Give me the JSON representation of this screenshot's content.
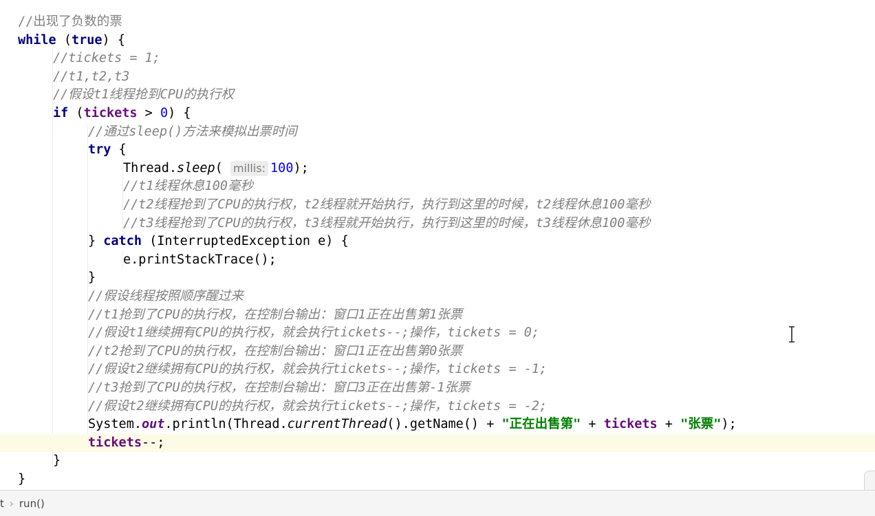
{
  "editor": {
    "lines": [
      {
        "indent": 1,
        "tokens": [
          {
            "t": "//出现了负数的票",
            "c": "cm-plain"
          }
        ]
      },
      {
        "indent": 1,
        "tokens": [
          {
            "t": "while",
            "c": "kw"
          },
          {
            "t": " (",
            "c": ""
          },
          {
            "t": "true",
            "c": "kw"
          },
          {
            "t": ") {",
            "c": ""
          }
        ]
      },
      {
        "indent": 2,
        "tokens": [
          {
            "t": "//tickets = 1;",
            "c": "cm"
          }
        ]
      },
      {
        "indent": 2,
        "tokens": [
          {
            "t": "//t1,t2,t3",
            "c": "cm"
          }
        ]
      },
      {
        "indent": 2,
        "tokens": [
          {
            "t": "//假设t1线程抢到CPU的执行权",
            "c": "cm"
          }
        ]
      },
      {
        "indent": 2,
        "tokens": [
          {
            "t": "if",
            "c": "kw"
          },
          {
            "t": " (",
            "c": ""
          },
          {
            "t": "tickets",
            "c": "field"
          },
          {
            "t": " > ",
            "c": ""
          },
          {
            "t": "0",
            "c": "num"
          },
          {
            "t": ") {",
            "c": ""
          }
        ]
      },
      {
        "indent": 3,
        "tokens": [
          {
            "t": "//通过sleep()方法来模拟出票时间",
            "c": "cm"
          }
        ]
      },
      {
        "indent": 3,
        "tokens": [
          {
            "t": "try",
            "c": "kw"
          },
          {
            "t": " {",
            "c": ""
          }
        ]
      },
      {
        "indent": 4,
        "tokens": [
          {
            "t": "Thread.",
            "c": ""
          },
          {
            "t": "sleep",
            "c": "static-italic"
          },
          {
            "t": "( ",
            "c": ""
          },
          {
            "t": "millis:",
            "c": "hint"
          },
          {
            "t": "100",
            "c": "num"
          },
          {
            "t": ");",
            "c": ""
          }
        ]
      },
      {
        "indent": 4,
        "tokens": [
          {
            "t": "//t1线程休息100毫秒",
            "c": "cm"
          }
        ]
      },
      {
        "indent": 4,
        "tokens": [
          {
            "t": "//t2线程抢到了CPU的执行权，t2线程就开始执行，执行到这里的时候，t2线程休息100毫秒",
            "c": "cm"
          }
        ]
      },
      {
        "indent": 4,
        "tokens": [
          {
            "t": "//t3线程抢到了CPU的执行权，t3线程就开始执行，执行到这里的时候，t3线程休息100毫秒",
            "c": "cm"
          }
        ]
      },
      {
        "indent": 3,
        "tokens": [
          {
            "t": "} ",
            "c": ""
          },
          {
            "t": "catch",
            "c": "kw"
          },
          {
            "t": " (InterruptedException e) {",
            "c": ""
          }
        ]
      },
      {
        "indent": 4,
        "tokens": [
          {
            "t": "e.printStackTrace();",
            "c": ""
          }
        ]
      },
      {
        "indent": 3,
        "tokens": [
          {
            "t": "}",
            "c": ""
          }
        ]
      },
      {
        "indent": 3,
        "tokens": [
          {
            "t": "//假设线程按照顺序醒过来",
            "c": "cm"
          }
        ]
      },
      {
        "indent": 3,
        "tokens": [
          {
            "t": "//t1抢到了CPU的执行权，在控制台输出：窗口1正在出售第1张票",
            "c": "cm"
          }
        ]
      },
      {
        "indent": 3,
        "tokens": [
          {
            "t": "//假设t1继续拥有CPU的执行权，就会执行tickets--;操作，tickets = 0;",
            "c": "cm"
          }
        ]
      },
      {
        "indent": 3,
        "tokens": [
          {
            "t": "//t2抢到了CPU的执行权，在控制台输出：窗口1正在出售第0张票",
            "c": "cm"
          }
        ]
      },
      {
        "indent": 3,
        "tokens": [
          {
            "t": "//假设t2继续拥有CPU的执行权，就会执行tickets--;操作，tickets = -1;",
            "c": "cm"
          }
        ]
      },
      {
        "indent": 3,
        "tokens": [
          {
            "t": "//t3抢到了CPU的执行权，在控制台输出：窗口3正在出售第-1张票",
            "c": "cm"
          }
        ]
      },
      {
        "indent": 3,
        "tokens": [
          {
            "t": "//假设t2继续拥有CPU的执行权，就会执行tickets--;操作，tickets = -2;",
            "c": "cm"
          }
        ]
      },
      {
        "indent": 3,
        "tokens": [
          {
            "t": "System.",
            "c": ""
          },
          {
            "t": "out",
            "c": "static-field"
          },
          {
            "t": ".println(Thread.",
            "c": ""
          },
          {
            "t": "currentThread",
            "c": "static-italic"
          },
          {
            "t": "().getName() + ",
            "c": ""
          },
          {
            "t": "\"正在出售第\"",
            "c": "str"
          },
          {
            "t": " + ",
            "c": ""
          },
          {
            "t": "tickets",
            "c": "field"
          },
          {
            "t": " + ",
            "c": ""
          },
          {
            "t": "\"张票\"",
            "c": "str"
          },
          {
            "t": ");",
            "c": ""
          }
        ]
      },
      {
        "indent": 3,
        "current": true,
        "tokens": [
          {
            "t": "tickets",
            "c": "field"
          },
          {
            "t": "--;",
            "c": ""
          }
        ]
      },
      {
        "indent": 2,
        "tokens": [
          {
            "t": "}",
            "c": ""
          }
        ]
      },
      {
        "indent": 1,
        "tokens": [
          {
            "t": "}",
            "c": ""
          }
        ]
      }
    ]
  },
  "breadcrumb": {
    "items": [
      "t",
      "run()"
    ],
    "separator": "›"
  },
  "colors": {
    "keyword": "#000080",
    "number": "#0000ff",
    "comment": "#808080",
    "string": "#008000",
    "field": "#660e7a",
    "current_line": "#fdfbe6"
  },
  "icons": [
    "text-cursor-icon",
    "breadcrumb-separator-icon"
  ]
}
